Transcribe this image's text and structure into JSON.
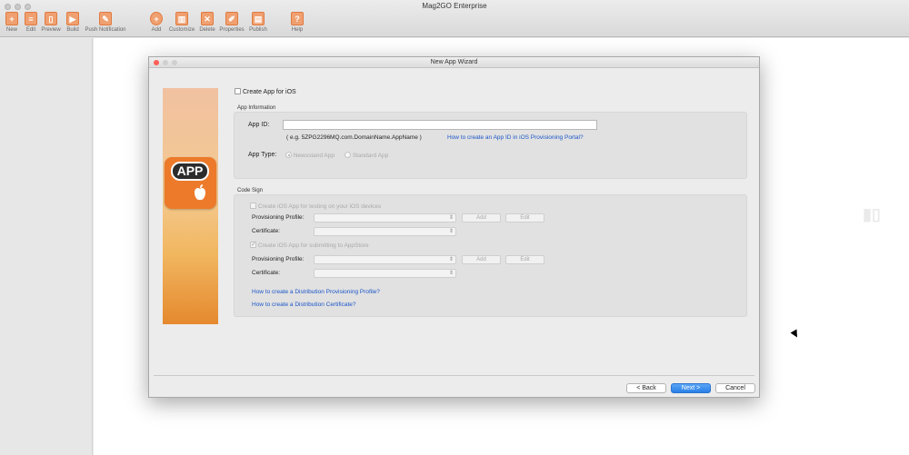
{
  "window": {
    "title": "Mag2GO Enterprise"
  },
  "toolbar": {
    "items": [
      {
        "label": "New",
        "icon": "new-document-icon"
      },
      {
        "label": "Edit",
        "icon": "edit-list-icon"
      },
      {
        "label": "Preview",
        "icon": "preview-icon"
      },
      {
        "label": "Build",
        "icon": "build-play-icon"
      },
      {
        "label": "Push Notification",
        "icon": "push-notification-icon"
      },
      {
        "label": "Add",
        "icon": "add-icon"
      },
      {
        "label": "Customize",
        "icon": "customize-book-icon"
      },
      {
        "label": "Delete",
        "icon": "delete-x-icon"
      },
      {
        "label": "Properties",
        "icon": "properties-pencil-icon"
      },
      {
        "label": "Publish",
        "icon": "publish-icon"
      },
      {
        "label": "Help",
        "icon": "help-icon"
      }
    ]
  },
  "dialog": {
    "title": "New App Wizard",
    "banner_logo_text": "APP",
    "create_ios_label": "Create App for iOS",
    "app_info": {
      "section_label": "App Information",
      "app_id_label": "App ID:",
      "app_id_value": "",
      "example_text": "( e.g. 5ZPG2296MQ.com.DomainName.AppName )",
      "howto_link": "How to create an App ID in iOS Provisioning Portal?",
      "app_type_label": "App Type:",
      "app_type_options": [
        "Newsstand App",
        "Standard App"
      ],
      "app_type_selected": "Newsstand App"
    },
    "code_sign": {
      "section_label": "Code Sign",
      "testing_label": "Create iOS App for testing on your iOS devices",
      "testing_checked": false,
      "submit_label": "Create iOS App for submitting to AppStore",
      "submit_checked": true,
      "provisioning_label": "Provisioning Profile:",
      "certificate_label": "Certificate:",
      "add_label": "Add",
      "edit_label": "Edit",
      "link_distribution_profile": "How to create a Distribution Provisioning Profile?",
      "link_distribution_cert": "How to create a Distribution Certificate?"
    },
    "buttons": {
      "back": "< Back",
      "next": "Next >",
      "cancel": "Cancel"
    }
  },
  "colors": {
    "accent": "#2a7fe6",
    "link": "#1b56c9",
    "toolbar_icon": "#f0a070"
  }
}
